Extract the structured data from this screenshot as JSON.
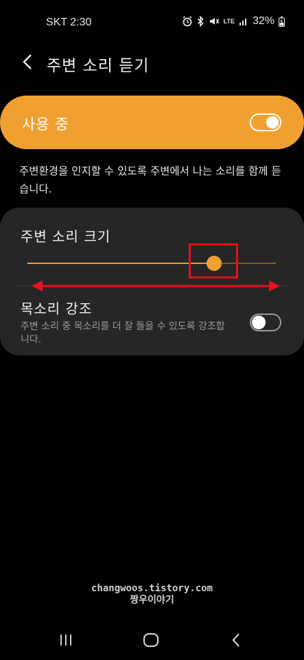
{
  "status_bar": {
    "carrier_time": "SKT 2:30",
    "network": "LTE",
    "battery": "32%",
    "icons": [
      "alarm-icon",
      "bluetooth-icon",
      "mute-icon",
      "lte-icon",
      "signal-icon",
      "battery-icon"
    ]
  },
  "header": {
    "title": "주변 소리 듣기",
    "back_icon": "chevron-left-icon"
  },
  "main_toggle": {
    "label": "사용 중",
    "on": true
  },
  "description": "주변환경을 인지할 수 있도록 주변에서 나는 소리를 함께 듣습니다.",
  "ambient_volume": {
    "label": "주변 소리 크기",
    "level": 0.75
  },
  "voice_focus": {
    "label": "목소리 강조",
    "subtitle": "주변 소리 중 목소리를 더 잘 들을 수 있도록 강조합니다.",
    "on": false
  },
  "watermark": {
    "line1": "changwoos.tistory.com",
    "line2": "짱우이야기"
  },
  "annotations": {
    "highlight_color": "#e8101a",
    "arrow_color": "#e8101a"
  },
  "colors": {
    "accent": "#f0a030",
    "card": "#262626",
    "background": "#000000"
  },
  "nav_bar": {
    "icons": [
      "recent-apps-icon",
      "home-icon",
      "back-icon"
    ]
  }
}
